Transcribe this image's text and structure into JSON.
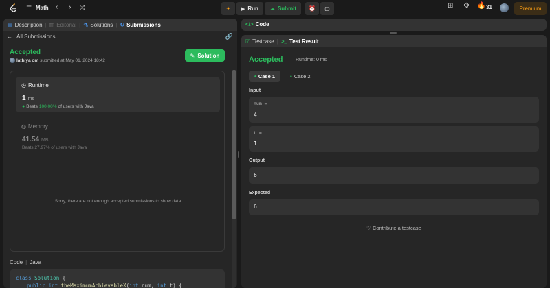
{
  "topbar": {
    "problem_list_title": "Math",
    "run_label": "Run",
    "submit_label": "Submit",
    "streak_count": "31",
    "premium_label": "Premium"
  },
  "left_tabs": {
    "description": "Description",
    "editorial": "Editorial",
    "solutions": "Solutions",
    "submissions": "Submissions"
  },
  "submission": {
    "back_label": "All Submissions",
    "status": "Accepted",
    "user": "lathiya om",
    "submitted_text": "submitted at May 01, 2024 18:42",
    "solution_button": "Solution",
    "runtime_label": "Runtime",
    "runtime_value": "1",
    "runtime_unit": "ms",
    "runtime_beats_prefix": "Beats",
    "runtime_beats_pct": "100.00%",
    "runtime_beats_suffix": "of users with Java",
    "memory_label": "Memory",
    "memory_value": "41.54",
    "memory_unit": "MB",
    "memory_beats": "Beats 27.97% of users with Java",
    "no_data_text": "Sorry, there are not enough accepted submissions to show data",
    "code_label": "Code",
    "language": "Java",
    "code_line1_kw": "class",
    "code_line1_cls": "Solution",
    "code_line1_rest": " {",
    "code_line2_kw": "public int",
    "code_line2_fn": "theMaximumAchievableX",
    "code_line2_p1": "(",
    "code_line2_kw2": "int",
    "code_line2_p2": " num, ",
    "code_line2_kw3": "int",
    "code_line2_p3": " t) {"
  },
  "code_panel": {
    "title": "Code"
  },
  "test_panel": {
    "testcase_tab": "Testcase",
    "result_tab": "Test Result",
    "status": "Accepted",
    "runtime": "Runtime: 0 ms",
    "case1": "Case 1",
    "case2": "Case 2",
    "input_label": "Input",
    "param1_name": "num =",
    "param1_value": "4",
    "param2_name": "t =",
    "param2_value": "1",
    "output_label": "Output",
    "output_value": "6",
    "expected_label": "Expected",
    "expected_value": "6",
    "contribute_label": "Contribute a testcase"
  },
  "colors": {
    "accent_green": "#2cbb5d",
    "premium_orange": "#ffa116",
    "panel_bg": "#262626"
  }
}
